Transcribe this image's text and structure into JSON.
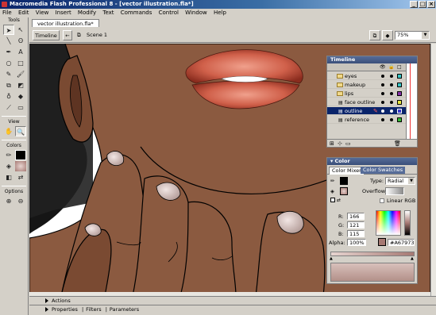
{
  "window": {
    "title": "Macromedia Flash Professional 8 - [vector illustration.fla*]"
  },
  "menu": [
    "File",
    "Edit",
    "View",
    "Insert",
    "Modify",
    "Text",
    "Commands",
    "Control",
    "Window",
    "Help"
  ],
  "tools_panel": {
    "title": "Tools",
    "view_label": "View",
    "colors_label": "Colors",
    "options_label": "Options"
  },
  "document": {
    "tab": "vector illustration.fla*",
    "timeline_button": "Timeline",
    "scene": "Scene 1",
    "zoom": "75%"
  },
  "timeline": {
    "title": "Timeline",
    "layers": [
      {
        "name": "eyes",
        "color": "#39c6c6"
      },
      {
        "name": "makeup",
        "color": "#39c6c6"
      },
      {
        "name": "lips",
        "color": "#8833aa"
      },
      {
        "name": "face outline",
        "color": "#e8e840"
      },
      {
        "name": "outline",
        "color": "#3838c8",
        "selected": true
      },
      {
        "name": "reference",
        "color": "#33bb33"
      }
    ]
  },
  "color_panel": {
    "title": "Color",
    "tabs": [
      "Color Mixer",
      "Color Swatches"
    ],
    "type_label": "Type:",
    "type_value": "Radial",
    "overflow_label": "Overflow:",
    "linear_rgb_label": "Linear RGB",
    "r_label": "R:",
    "r": "166",
    "g_label": "G:",
    "g": "121",
    "b_label": "B:",
    "b": "115",
    "alpha_label": "Alpha:",
    "alpha": "100%",
    "hex": "#A67973"
  },
  "bottom_panels": {
    "actions": "Actions",
    "properties": "Properties",
    "filters": "Filters",
    "parameters": "Parameters"
  },
  "colors": {
    "skin": "#8b5a40",
    "lip": "#c0503c",
    "hair": "#1a1a1a",
    "nail": "#c9b5b0"
  }
}
